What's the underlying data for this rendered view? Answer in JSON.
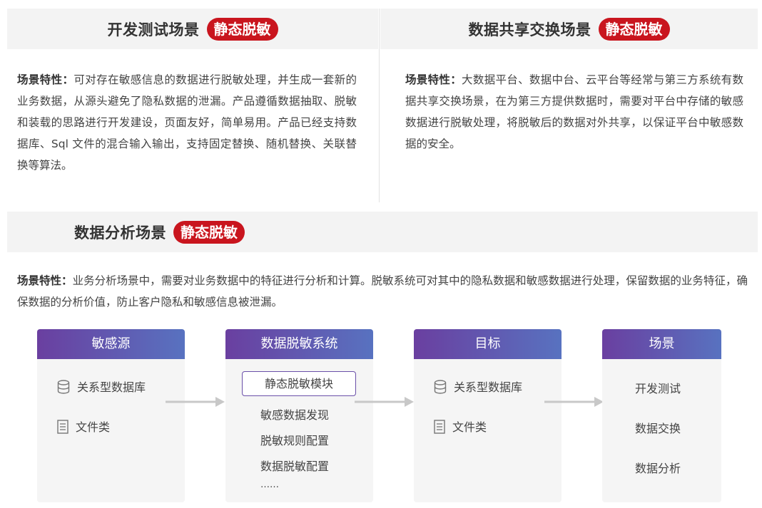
{
  "sections": {
    "dev": {
      "title": "开发测试场景",
      "badge": "静态脱敏",
      "label": "场景特性：",
      "text": "可对存在敏感信息的数据进行脱敏处理，并生成一套新的业务数据，从源头避免了隐私数据的泄漏。产品遵循数据抽取、脱敏和装载的思路进行开发建设，页面友好，简单易用。产品已经支持数据库、Sql 文件的混合输入输出，支持固定替换、随机替换、关联替换等算法。"
    },
    "share": {
      "title": "数据共享交换场景",
      "badge": "静态脱敏",
      "label": "场景特性：",
      "text": "大数据平台、数据中台、云平台等经常与第三方系统有数据共享交换场景，在为第三方提供数据时，需要对平台中存储的敏感数据进行脱敏处理，将脱敏后的数据对外共享，以保证平台中敏感数据的安全。"
    },
    "analysis": {
      "title": "数据分析场景",
      "badge": "静态脱敏",
      "label": "场景特性：",
      "text": "业务分析场景中，需要对业务数据中的特征进行分析和计算。脱敏系统可对其中的隐私数据和敏感数据进行处理，保留数据的业务特征，确保数据的分析价值，防止客户隐私和敏感信息被泄漏。"
    }
  },
  "flow": {
    "source": {
      "title": "敏感源",
      "items": [
        {
          "icon": "database-icon",
          "label": "关系型数据库"
        },
        {
          "icon": "document-icon",
          "label": "文件类"
        }
      ]
    },
    "system": {
      "title": "数据脱敏系统",
      "highlight": "静态脱敏模块",
      "items": [
        "敏感数据发现",
        "脱敏规则配置",
        "数据脱敏配置",
        "……"
      ]
    },
    "target": {
      "title": "目标",
      "items": [
        {
          "icon": "database-icon",
          "label": "关系型数据库"
        },
        {
          "icon": "document-icon",
          "label": "文件类"
        }
      ]
    },
    "scene": {
      "title": "场景",
      "items": [
        "开发测试",
        "数据交换",
        "数据分析"
      ]
    }
  },
  "colors": {
    "badge": "#c9151e",
    "header_bg": "#f3f3f3",
    "gradient_start": "#6a3fa0",
    "gradient_end": "#5872c0",
    "arrow": "#c8c8c8"
  }
}
